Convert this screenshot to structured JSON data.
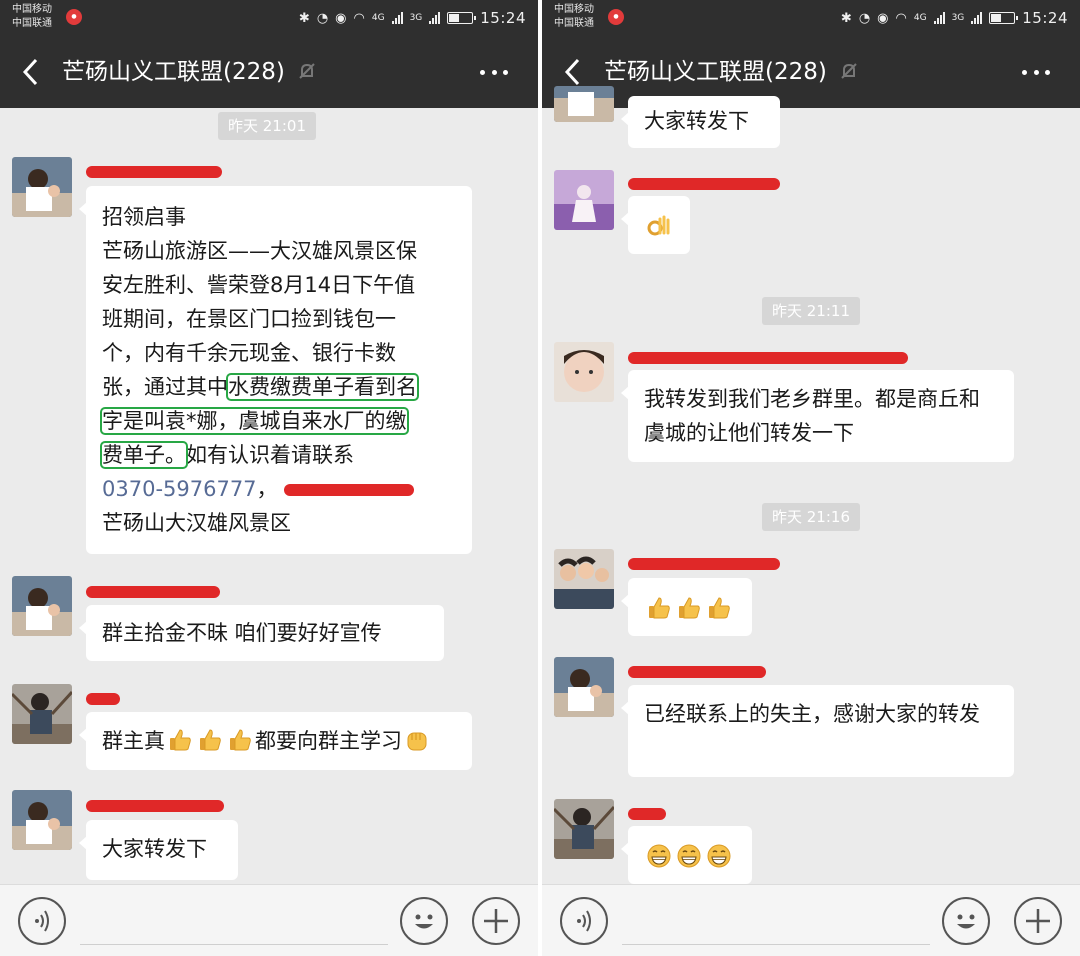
{
  "status_bar": {
    "carrier_1": "中国移动",
    "carrier_2": "中国联通",
    "net_4g": "4G",
    "net_3g": "3G",
    "time": "15:24"
  },
  "chat": {
    "title": "芒砀山义工联盟(228)"
  },
  "left": {
    "timestamp": "昨天 21:01",
    "notice": {
      "line1": "招领启事",
      "line2": "芒砀山旅游区——大汉雄风景区保",
      "line3": "安左胜利、訾荣登8月14日下午值",
      "line4": "班期间，在景区门口捡到钱包一",
      "line5": "个，内有千余元现金、银行卡数",
      "line6_pre": "张，通过其中",
      "line6_hl": "水费缴费单子看到名",
      "line7_hl": "字是叫袁*娜，虞城自来水厂的缴",
      "line8_hl": "费单子。",
      "line8_post": "如有认识着请联系",
      "phone": "0370-5976777",
      "phone_sep": "，",
      "line10": "芒砀山大汉雄风景区"
    },
    "msg2": "群主拾金不昧   咱们要好好宣传",
    "msg3_pre": "群主真",
    "msg3_post": "都要向群主学习",
    "msg4": "大家转发下"
  },
  "right": {
    "msg1": "大家转发下",
    "timestamp1": "昨天 21:11",
    "msg3": "我转发到我们老乡群里。都是商丘和虞城的让他们转发一下",
    "timestamp2": "昨天 21:16",
    "msg5": "已经联系上的失主，感谢大家的转发"
  },
  "icons": {
    "thumbs_up": "thumbs-up-emoji",
    "fist": "fist-emoji",
    "ok_hand": "ok-hand-emoji",
    "grin": "grin-emoji"
  },
  "colors": {
    "header_bg": "#2f2f2f",
    "chat_bg": "#ebebeb",
    "bubble": "#ffffff",
    "redaction": "#e02828",
    "highlight_box": "#28a745",
    "link": "#576b95"
  }
}
